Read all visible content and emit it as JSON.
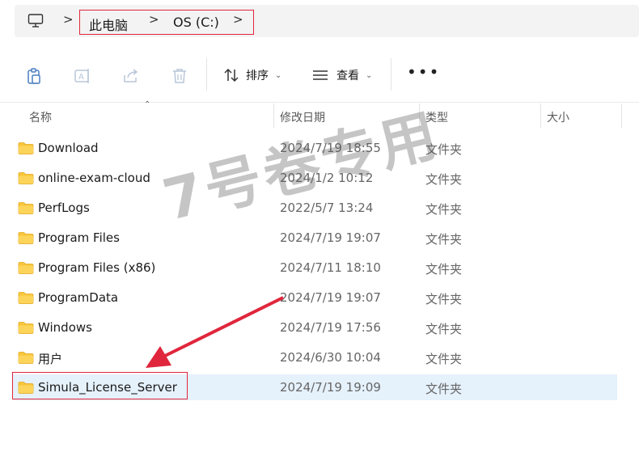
{
  "address_bar": {
    "crumbs": [
      "此电脑",
      "OS (C:)"
    ],
    "separator": ">"
  },
  "toolbar": {
    "sort_label": "排序",
    "view_label": "查看",
    "more_label": "•••"
  },
  "columns": {
    "name": "名称",
    "modified": "修改日期",
    "type": "类型",
    "size": "大小"
  },
  "files": [
    {
      "name": "Download",
      "modified": "2024/7/19 18:55",
      "type": "文件夹"
    },
    {
      "name": "online-exam-cloud",
      "modified": "2024/1/2 10:12",
      "type": "文件夹"
    },
    {
      "name": "PerfLogs",
      "modified": "2022/5/7 13:24",
      "type": "文件夹"
    },
    {
      "name": "Program Files",
      "modified": "2024/7/19 19:07",
      "type": "文件夹"
    },
    {
      "name": "Program Files (x86)",
      "modified": "2024/7/11 18:10",
      "type": "文件夹"
    },
    {
      "name": "ProgramData",
      "modified": "2024/7/19 19:07",
      "type": "文件夹"
    },
    {
      "name": "Windows",
      "modified": "2024/7/19 17:56",
      "type": "文件夹"
    },
    {
      "name": "用户",
      "modified": "2024/6/30 10:04",
      "type": "文件夹"
    },
    {
      "name": "Simula_License_Server",
      "modified": "2024/7/19 19:09",
      "type": "文件夹"
    }
  ],
  "watermark": "7号卷专用",
  "colors": {
    "highlight_red": "#e0263c",
    "selection_bg": "#e5f1fb",
    "folder_yellow": "#f8c63b"
  }
}
